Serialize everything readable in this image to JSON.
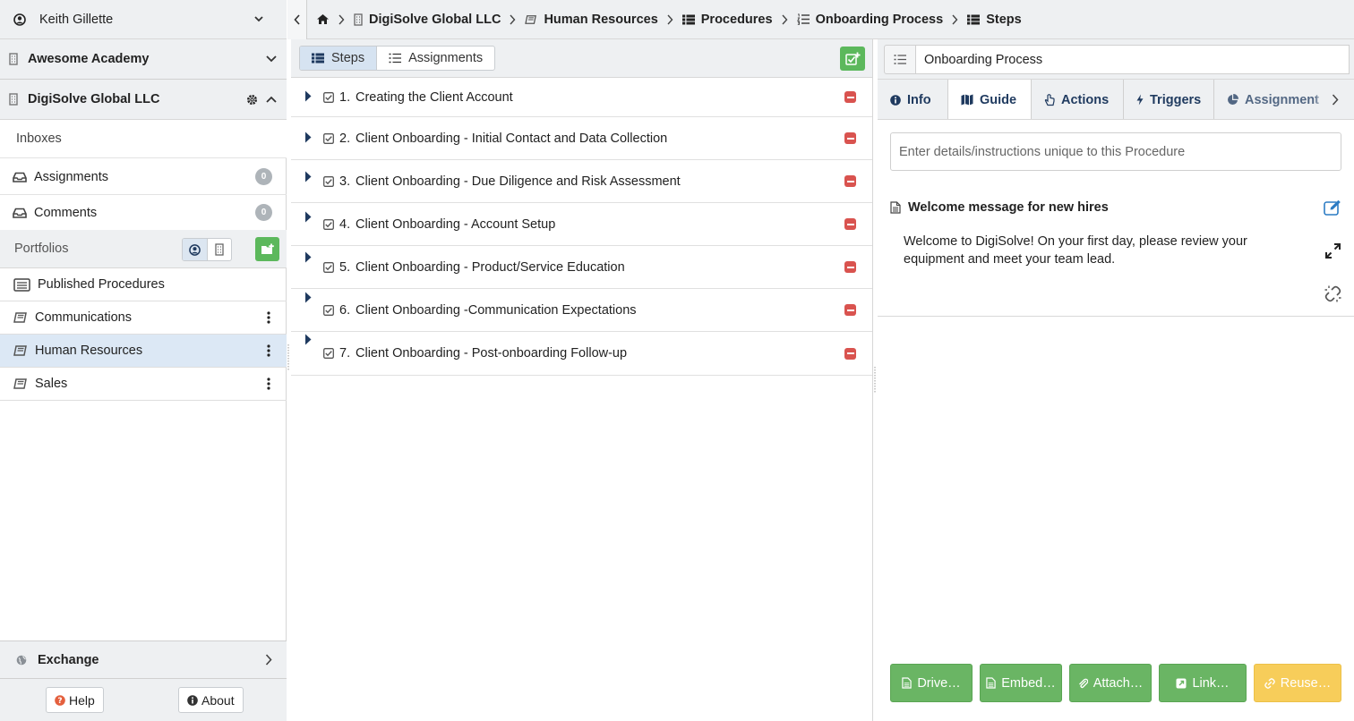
{
  "user": {
    "name": "Keith Gillette"
  },
  "orgs": [
    {
      "name": "Awesome Academy"
    },
    {
      "name": "DigiSolve Global LLC"
    }
  ],
  "inboxes": {
    "label": "Inboxes",
    "items": [
      {
        "label": "Assignments",
        "count": "0"
      },
      {
        "label": "Comments",
        "count": "0"
      }
    ]
  },
  "portfolios": {
    "label": "Portfolios",
    "published_label": "Published Procedures",
    "items": [
      {
        "label": "Communications",
        "selected": false
      },
      {
        "label": "Human Resources",
        "selected": true
      },
      {
        "label": "Sales",
        "selected": false
      }
    ]
  },
  "exchange": {
    "label": "Exchange"
  },
  "footer": {
    "help_label": "Help",
    "about_label": "About"
  },
  "breadcrumbs": [
    {
      "label": "DigiSolve Global LLC",
      "icon": "building-icon"
    },
    {
      "label": "Human Resources",
      "icon": "book-icon"
    },
    {
      "label": "Procedures",
      "icon": "table-icon"
    },
    {
      "label": "Onboarding Process",
      "icon": "list-ol-icon"
    },
    {
      "label": "Steps",
      "icon": "table-icon"
    }
  ],
  "steps_toolbar": {
    "steps_tab": "Steps",
    "assignments_tab": "Assignments"
  },
  "steps": [
    {
      "num": "1.",
      "title": "Creating the Client Account"
    },
    {
      "num": "2.",
      "title": "Client Onboarding - Initial Contact and Data Collection"
    },
    {
      "num": "3.",
      "title": "Client Onboarding - Due Diligence and Risk Assessment"
    },
    {
      "num": "4.",
      "title": "Client Onboarding - Account Setup"
    },
    {
      "num": "5.",
      "title": "Client Onboarding - Product/Service Education"
    },
    {
      "num": "6.",
      "title": "Client Onboarding -Communication Expectations"
    },
    {
      "num": "7.",
      "title": "Client Onboarding - Post-onboarding Follow-up"
    }
  ],
  "detail": {
    "procedure_name": "Onboarding Process",
    "tabs": [
      {
        "label": "Info",
        "icon": "info-icon"
      },
      {
        "label": "Guide",
        "icon": "map-icon",
        "active": true
      },
      {
        "label": "Actions",
        "icon": "pointer-icon"
      },
      {
        "label": "Triggers",
        "icon": "bolt-icon"
      },
      {
        "label": "Assignment",
        "icon": "pie-icon"
      }
    ],
    "instructions_placeholder": "Enter details/instructions unique to this Procedure",
    "guide_item": {
      "title": "Welcome message for new hires",
      "body": "Welcome to DigiSolve! On your first day, please review your equipment and meet your team lead."
    },
    "bottom_buttons": [
      {
        "label": "Drive…",
        "color": "green"
      },
      {
        "label": "Embed…",
        "color": "green"
      },
      {
        "label": "Attach…",
        "color": "green"
      },
      {
        "label": "Link…",
        "color": "green"
      },
      {
        "label": "Reuse…",
        "color": "yellow"
      }
    ]
  },
  "colors": {
    "accent_green": "#5cb85c",
    "selected_row": "#dce8f5",
    "remove_red": "#d9534f",
    "reuse_yellow": "#f7cd5a"
  }
}
